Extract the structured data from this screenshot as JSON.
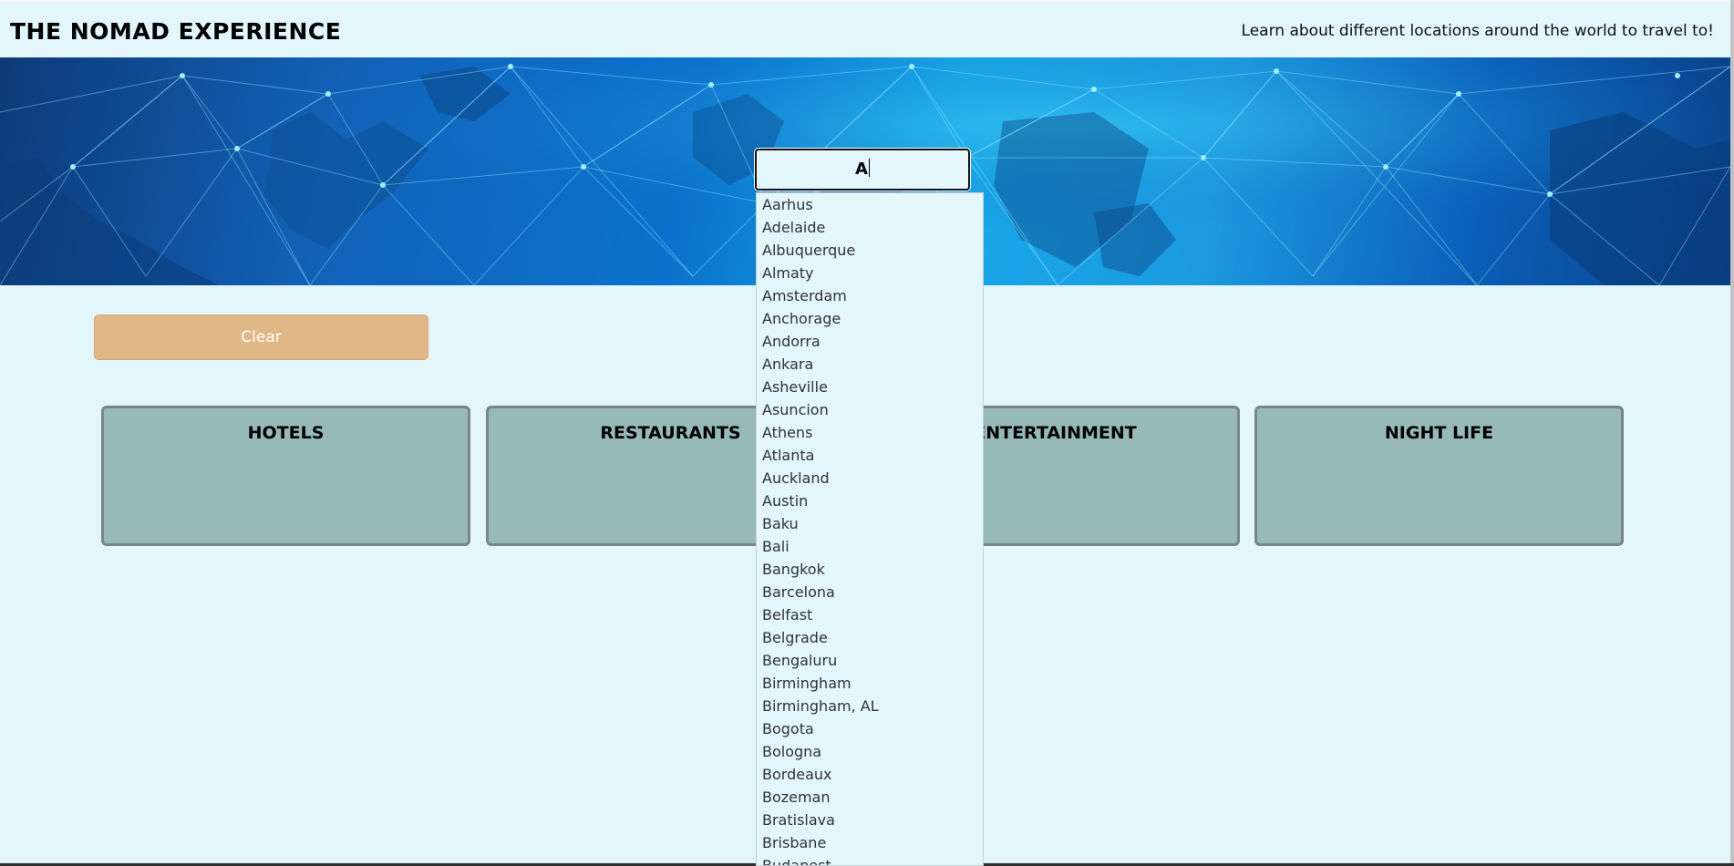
{
  "header": {
    "title": "THE NOMAD EXPERIENCE",
    "tagline": "Learn about different locations around the world to travel to!"
  },
  "search": {
    "value": "A",
    "suggestions": [
      "Aarhus",
      "Adelaide",
      "Albuquerque",
      "Almaty",
      "Amsterdam",
      "Anchorage",
      "Andorra",
      "Ankara",
      "Asheville",
      "Asuncion",
      "Athens",
      "Atlanta",
      "Auckland",
      "Austin",
      "Baku",
      "Bali",
      "Bangkok",
      "Barcelona",
      "Belfast",
      "Belgrade",
      "Bengaluru",
      "Birmingham",
      "Birmingham, AL",
      "Bogota",
      "Bologna",
      "Bordeaux",
      "Bozeman",
      "Bratislava",
      "Brisbane",
      "Budapest"
    ]
  },
  "controls": {
    "clear_label": "Clear"
  },
  "categories": [
    {
      "label": "HOTELS"
    },
    {
      "label": "RESTAURANTS"
    },
    {
      "label": "ENTERTAINMENT"
    },
    {
      "label": "NIGHT LIFE"
    }
  ],
  "colors": {
    "background": "#e2f6fc",
    "clear_button": "#e0b887",
    "card": "#97b9b8",
    "card_border": "#7a8586"
  },
  "icons": {
    "hero": "world-network-map-banner"
  }
}
